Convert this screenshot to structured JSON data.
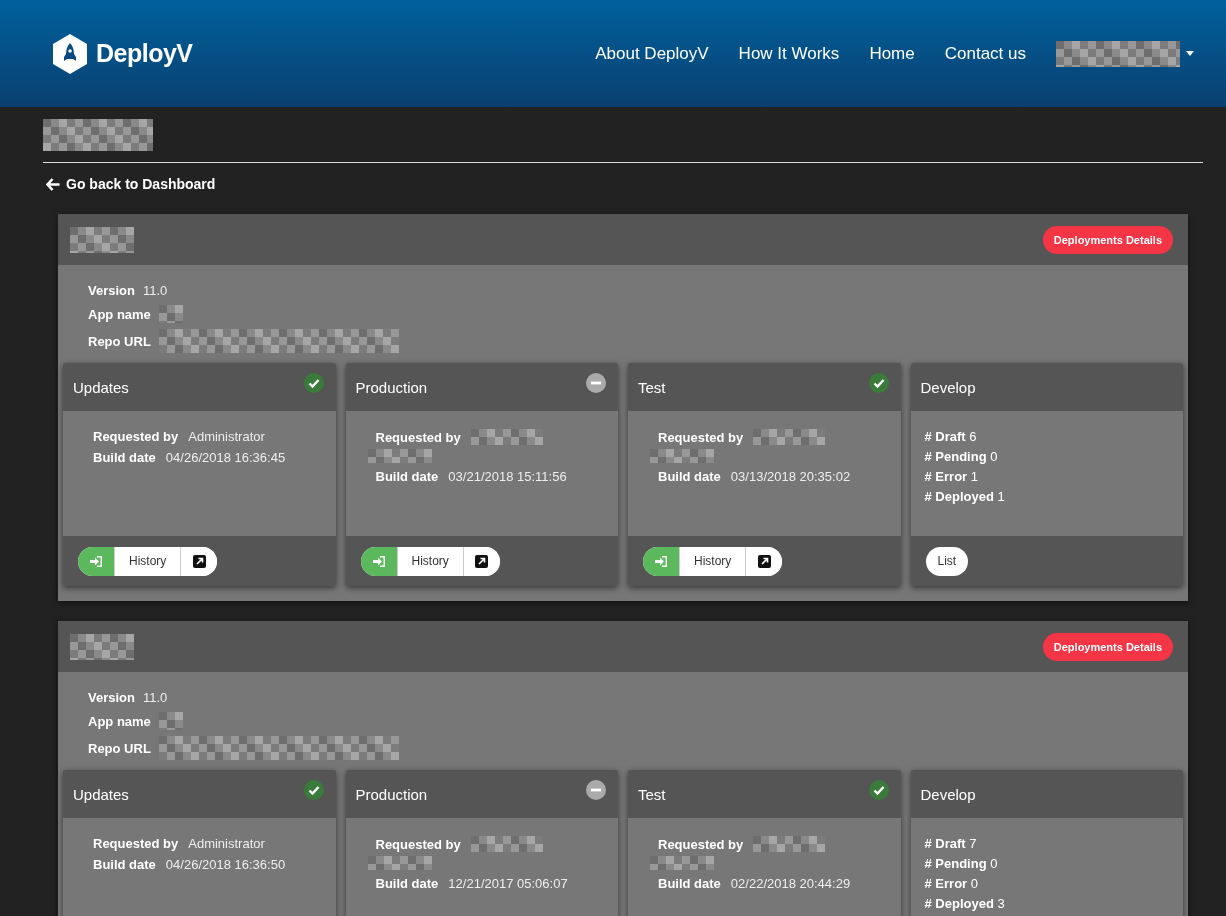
{
  "brand": {
    "name": "DeployV"
  },
  "nav": [
    {
      "label": "About DeployV"
    },
    {
      "label": "How It Works"
    },
    {
      "label": "Home"
    },
    {
      "label": "Contact us"
    }
  ],
  "back_link": "Go back to Dashboard",
  "projects": [
    {
      "details_button": "Deployments Details",
      "info": [
        {
          "label": "Version",
          "value": "11.0"
        },
        {
          "label": "App name"
        },
        {
          "label": "Repo URL"
        }
      ],
      "stages": [
        {
          "kind": "build",
          "title": "Updates",
          "succeeded": true,
          "fields": [
            {
              "label": "Requested by",
              "value": "Administrator"
            },
            {
              "label": "Build date",
              "value": "04/26/2018 16:36:45"
            }
          ],
          "buttons": [
            "History"
          ]
        },
        {
          "kind": "build",
          "title": "Production",
          "succeeded": false,
          "fields": [
            {
              "label": "Requested by"
            },
            {
              "label": "Build date",
              "value": "03/21/2018 15:11:56"
            }
          ],
          "buttons": [
            "History"
          ]
        },
        {
          "kind": "build",
          "title": "Test",
          "succeeded": true,
          "fields": [
            {
              "label": "Requested by"
            },
            {
              "label": "Build date",
              "value": "03/13/2018 20:35:02"
            }
          ],
          "buttons": [
            "History"
          ]
        },
        {
          "kind": "stats",
          "title": "Develop",
          "stats": [
            {
              "label": "# Draft",
              "value": "6"
            },
            {
              "label": "# Pending",
              "value": "0"
            },
            {
              "label": "# Error",
              "value": "1"
            },
            {
              "label": "# Deployed",
              "value": "1"
            }
          ],
          "buttons": [
            "List"
          ]
        }
      ]
    },
    {
      "details_button": "Deployments Details",
      "info": [
        {
          "label": "Version",
          "value": "11.0"
        },
        {
          "label": "App name"
        },
        {
          "label": "Repo URL"
        }
      ],
      "stages": [
        {
          "kind": "build",
          "title": "Updates",
          "succeeded": true,
          "fields": [
            {
              "label": "Requested by",
              "value": "Administrator"
            },
            {
              "label": "Build date",
              "value": "04/26/2018 16:36:50"
            }
          ]
        },
        {
          "kind": "build",
          "title": "Production",
          "succeeded": false,
          "fields": [
            {
              "label": "Requested by"
            },
            {
              "label": "Build date",
              "value": "12/21/2017 05:06:07"
            }
          ]
        },
        {
          "kind": "build",
          "title": "Test",
          "succeeded": true,
          "fields": [
            {
              "label": "Requested by"
            },
            {
              "label": "Build date",
              "value": "02/22/2018 20:44:29"
            }
          ]
        },
        {
          "kind": "stats",
          "title": "Develop",
          "stats": [
            {
              "label": "# Draft",
              "value": "7"
            },
            {
              "label": "# Pending",
              "value": "0"
            },
            {
              "label": "# Error",
              "value": "0"
            },
            {
              "label": "# Deployed",
              "value": "3"
            }
          ]
        }
      ]
    }
  ]
}
